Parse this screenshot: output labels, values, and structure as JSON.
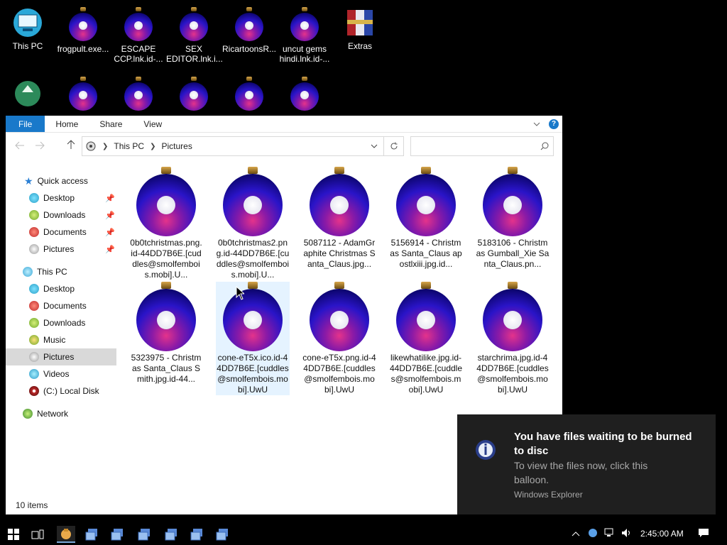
{
  "desktop": {
    "icons": [
      {
        "label": "This PC",
        "kind": "pc"
      },
      {
        "label": "frogpult.exe...",
        "kind": "ornament"
      },
      {
        "label": "ESCAPE CCP.lnk.id-...",
        "kind": "ornament"
      },
      {
        "label": "SEX EDITOR.lnk.i...",
        "kind": "ornament"
      },
      {
        "label": "RicartoonsR...",
        "kind": "ornament"
      },
      {
        "label": "uncut gems hindi.lnk.id-...",
        "kind": "ornament"
      },
      {
        "label": "Extras",
        "kind": "winrar"
      }
    ]
  },
  "window": {
    "ribbon": {
      "file": "File",
      "home": "Home",
      "share": "Share",
      "view": "View",
      "help": "?"
    },
    "breadcrumb": [
      "This PC",
      "Pictures"
    ],
    "nav": {
      "quick_access": "Quick access",
      "quick_items": [
        "Desktop",
        "Downloads",
        "Documents",
        "Pictures"
      ],
      "this_pc": "This PC",
      "pc_items": [
        "Desktop",
        "Documents",
        "Downloads",
        "Music",
        "Pictures",
        "Videos",
        "(C:) Local Disk"
      ],
      "network": "Network"
    },
    "files": [
      "0b0tchristmas.png.id-44DD7B6E.[cuddles@smolfembois.mobi].U...",
      "0b0tchristmas2.png.id-44DD7B6E.[cuddles@smolfembois.mobi].U...",
      "5087112 - AdamGraphite Christmas Santa_Claus.jpg...",
      "5156914 - Christmas Santa_Claus apostlxiii.jpg.id...",
      "5183106 - Christmas Gumball_Xie Santa_Claus.pn...",
      "5323975 - Christmas Santa_Claus Smith.jpg.id-44...",
      "cone-eT5x.ico.id-44DD7B6E.[cuddles@smolfembois.mobi].UwU",
      "cone-eT5x.png.id-44DD7B6E.[cuddles@smolfembois.mobi].UwU",
      "likewhatilike.jpg.id-44DD7B6E.[cuddles@smolfembois.mobi].UwU",
      "starchrima.jpg.id-44DD7B6E.[cuddles@smolfembois.mobi].UwU"
    ],
    "selected_file_index": 6,
    "status": "10 items"
  },
  "toast": {
    "title": "You have files waiting to be burned to disc",
    "body": "To view the files now, click this balloon.",
    "source": "Windows Explorer"
  },
  "taskbar": {
    "clock": "2:45:00 AM"
  },
  "colors": {
    "accent": "#1979ca",
    "selection": "#e5f3ff",
    "nav_selected": "#d9d9d9",
    "toast_bg": "#1f1f1f"
  }
}
